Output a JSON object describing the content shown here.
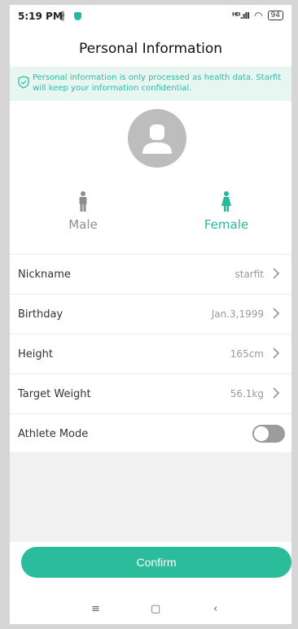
{
  "status": {
    "time": "5:19 PM",
    "signal": "ᴴᴰ.ıll",
    "wifi": "◠",
    "battery": "94"
  },
  "header": {
    "title": "Personal Information"
  },
  "notice": {
    "text": "Personal information is only processed as health data. Starfit will keep your information confidential."
  },
  "gender": {
    "male_label": "Male",
    "female_label": "Female",
    "selected": "Female"
  },
  "fields": [
    {
      "label": "Nickname",
      "value": "starfit"
    },
    {
      "label": "Birthday",
      "value": "Jan.3,1999"
    },
    {
      "label": "Height",
      "value": "165cm"
    },
    {
      "label": "Target Weight",
      "value": "56.1kg"
    },
    {
      "label": "Athlete Mode",
      "value": ""
    }
  ],
  "athlete_mode_on": false,
  "actions": {
    "confirm_label": "Confirm"
  },
  "navbar": {
    "menu": "≡",
    "home": "▢",
    "back": "‹"
  },
  "colors": {
    "accent": "#2bbc9c",
    "muted": "#8e8e8e"
  }
}
